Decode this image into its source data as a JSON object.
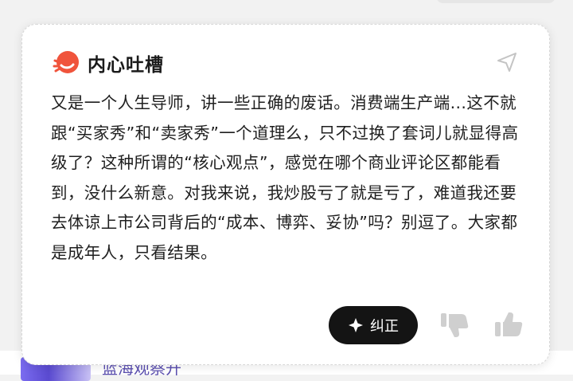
{
  "card": {
    "title": "内心吐槽",
    "body": "又是一个人生导师，讲一些正确的废话。消费端生产端...这不就跟“买家秀”和“卖家秀”一个道理么，只不过换了套词儿就显得高级了？这种所谓的“核心观点”，感觉在哪个商业评论区都能看到，没什么新意。对我来说，我炒股亏了就是亏了，难道我还要去体谅上市公司背后的“成本、博弈、妥协”吗？别逗了。大家都是成年人，只看结果。",
    "correct_label": "纠正",
    "icons": {
      "logo": "speech-bubble-logo-icon",
      "share": "send-arrow-icon",
      "correct": "sparkle-icon",
      "dislike": "thumbs-down-icon",
      "like": "thumbs-up-icon"
    },
    "colors": {
      "logo_red": "#f0543c",
      "button_bg": "#141414",
      "icon_gray": "#cfcfcf"
    }
  },
  "below": {
    "title_fragment": "蓝海观察开"
  }
}
